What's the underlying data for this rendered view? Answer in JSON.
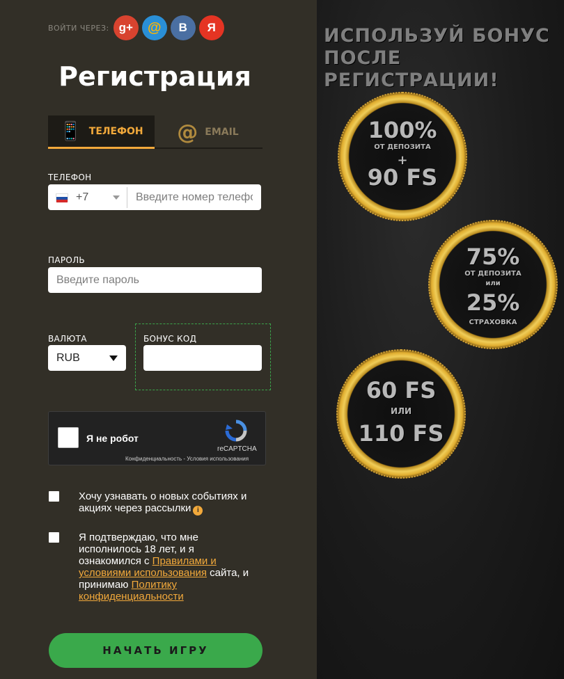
{
  "social": {
    "label": "ВОЙТИ ЧЕРЕЗ:",
    "providers": [
      {
        "icon": "google-plus-icon",
        "glyph": "g+"
      },
      {
        "icon": "mail-ru-icon",
        "glyph": "@"
      },
      {
        "icon": "vk-icon",
        "glyph": "В"
      },
      {
        "icon": "yandex-icon",
        "glyph": "Я"
      }
    ]
  },
  "form": {
    "title": "Регистрация",
    "tabs": [
      {
        "label": "ТЕЛЕФОН",
        "icon": "phone-hand-icon",
        "active": true
      },
      {
        "label": "EMAIL",
        "icon": "at-icon",
        "active": false
      }
    ],
    "phone": {
      "label": "ТЕЛЕФОН",
      "code": "+7",
      "placeholder": "Введите номер телефона"
    },
    "password": {
      "label": "ПАРОЛЬ",
      "placeholder": "Введите пароль"
    },
    "currency": {
      "label": "ВАЛЮТА",
      "value": "RUB"
    },
    "bonus": {
      "label": "БОНУС КОД",
      "value": ""
    },
    "captcha": {
      "text": "Я не робот",
      "brand": "reCAPTCHA",
      "links": "Конфиденциальность - Условия использования"
    },
    "newsletter": {
      "text": "Хочу узнавать о новых событиях и акциях через рассылки"
    },
    "agree": {
      "text1": "Я подтверждаю, что мне исполнилось 18 лет, и я ознакомился с ",
      "link1": "Правилами и условиями использования",
      "text2": " сайта, и принимаю ",
      "link2": "Политику конфиденциальности"
    },
    "submit": "НАЧАТЬ ИГРУ"
  },
  "promo": {
    "title_line1": "ИСПОЛЬЗУЙ БОНУС",
    "title_line2": "ПОСЛЕ РЕГИСТРАЦИИ!",
    "coins": [
      {
        "l1": "100%",
        "l2": "ОТ ДЕПОЗИТА",
        "l3": "+",
        "l4": "90 FS"
      },
      {
        "l1": "75%",
        "l2": "ОТ ДЕПОЗИТА",
        "l3": "или",
        "l4": "25%",
        "l5": "СТРАХОВКА"
      },
      {
        "l1": "60 FS",
        "l2": "ИЛИ",
        "l3": "110 FS"
      }
    ]
  },
  "colors": {
    "accent": "#f2a93b",
    "button": "#3aa94b",
    "panel": "#322f27"
  }
}
